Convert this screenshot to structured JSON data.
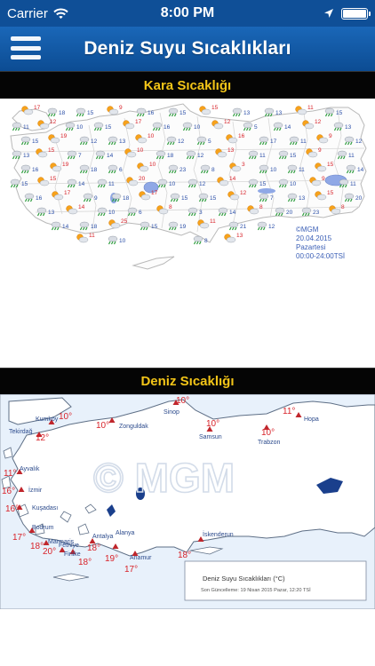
{
  "status": {
    "carrier": "Carrier",
    "time": "8:00 PM"
  },
  "header": {
    "title": "Deniz Suyu Sıcaklıkları"
  },
  "land": {
    "section_label": "Kara Sıcaklığı",
    "stamp_brand": "©MGM",
    "stamp_date": "20.04.2015",
    "stamp_day": "Pazartesi",
    "stamp_hours": "00:00-24:00TSİ",
    "temps": [
      "17",
      "18",
      "15",
      "9",
      "16",
      "15",
      "15",
      "13",
      "13",
      "11",
      "15",
      "11",
      "12",
      "10",
      "15",
      "17",
      "16",
      "10",
      "12",
      "5",
      "14",
      "12",
      "13",
      "15",
      "19",
      "12",
      "13",
      "10",
      "12",
      "5",
      "16",
      "17",
      "11",
      "9",
      "12",
      "13",
      "15",
      "7",
      "14",
      "10",
      "18",
      "12",
      "13",
      "11",
      "15",
      "9",
      "11",
      "16",
      "19",
      "18",
      "6",
      "10",
      "23",
      "8",
      "3",
      "10",
      "11",
      "15",
      "14",
      "15",
      "15",
      "14",
      "11",
      "20",
      "10",
      "12",
      "14",
      "15",
      "10",
      "9",
      "11",
      "16",
      "17",
      "9",
      "18",
      "17",
      "15",
      "15",
      "12",
      "7",
      "13",
      "15",
      "20",
      "13",
      "14",
      "10",
      "6",
      "8",
      "3",
      "14",
      "8",
      "20",
      "23",
      "8",
      "14",
      "18",
      "25",
      "15",
      "19",
      "11",
      "21",
      "12",
      "11",
      "10",
      "8",
      "13",
      "17",
      "21",
      "21",
      "10",
      "12",
      "21",
      "23",
      "7",
      "14",
      "16",
      "19"
    ]
  },
  "sea": {
    "section_label": "Deniz Sıcaklığı",
    "watermark": "© MGM",
    "legend_title": "Deniz Suyu Sıcaklıkları (°C)",
    "legend_updated": "Son Güncelleme: 19 Nisan 2015 Pazar, 12:20 TSİ",
    "stations": [
      {
        "name": "Kumköy",
        "temp": "10°"
      },
      {
        "name": "Tekirdağ",
        "temp": "12°"
      },
      {
        "name": "Zonguldak",
        "temp": "10°"
      },
      {
        "name": "Sinop",
        "temp": "10°"
      },
      {
        "name": "Samsun",
        "temp": "10°"
      },
      {
        "name": "Trabzon",
        "temp": "10°"
      },
      {
        "name": "Hopa",
        "temp": "11°"
      },
      {
        "name": "Ayvalık",
        "temp": "11°"
      },
      {
        "name": "İzmir",
        "temp": "16°"
      },
      {
        "name": "Kuşadası",
        "temp": "16°"
      },
      {
        "name": "Bodrum",
        "temp": "17°"
      },
      {
        "name": "Marmaris",
        "temp": "18°"
      },
      {
        "name": "Fethiye",
        "temp": "20°"
      },
      {
        "name": "Finike",
        "temp": "18°"
      },
      {
        "name": "Antalya",
        "temp": "18°"
      },
      {
        "name": "Alanya",
        "temp": "19°"
      },
      {
        "name": "Anamur",
        "temp": "17°"
      },
      {
        "name": "İskenderun",
        "temp": "18°"
      }
    ]
  },
  "colors": {
    "header": "#0f4f97",
    "section_bg": "#050505",
    "section_text": "#f3c518",
    "temp_red": "#d8232a",
    "station_blue": "#2b4a8c"
  }
}
